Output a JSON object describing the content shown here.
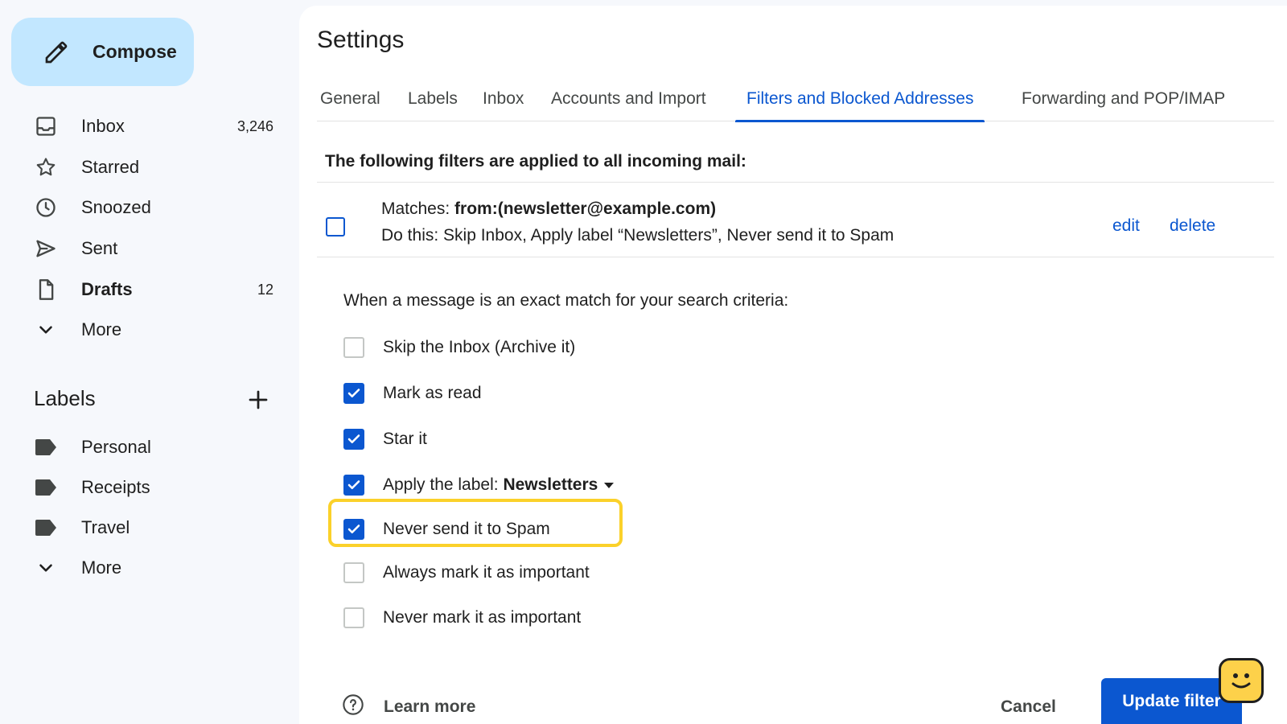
{
  "sidebar": {
    "compose_label": "Compose",
    "nav": [
      {
        "label": "Inbox",
        "count": "3,246",
        "icon": "inbox-icon"
      },
      {
        "label": "Starred",
        "count": "",
        "icon": "star-icon"
      },
      {
        "label": "Snoozed",
        "count": "",
        "icon": "clock-icon"
      },
      {
        "label": "Sent",
        "count": "",
        "icon": "send-icon"
      },
      {
        "label": "Drafts",
        "count": "12",
        "icon": "draft-icon"
      },
      {
        "label": "More",
        "count": "",
        "icon": "chevron-down-icon"
      }
    ],
    "labels_heading": "Labels",
    "labels": [
      {
        "label": "Personal",
        "icon": "label-icon"
      },
      {
        "label": "Receipts",
        "icon": "label-icon"
      },
      {
        "label": "Travel",
        "icon": "label-icon"
      },
      {
        "label": "More",
        "icon": "chevron-down-icon"
      }
    ]
  },
  "main": {
    "title": "Settings",
    "tabs": [
      {
        "label": "General"
      },
      {
        "label": "Labels"
      },
      {
        "label": "Inbox"
      },
      {
        "label": "Accounts and Import"
      },
      {
        "label": "Filters and Blocked Addresses",
        "active": true
      },
      {
        "label": "Forwarding and POP/IMAP"
      }
    ],
    "section_title": "The following filters are applied to all incoming mail:",
    "filter": {
      "matches_prefix": "Matches:",
      "matches_value": "from:(newsletter@example.com)",
      "action": "Do this: Skip Inbox, Apply label “Newsletters”, Never send it to Spam",
      "edit_label": "edit",
      "delete_label": "delete"
    },
    "criteria_text": "When a message is an exact match for your search criteria:",
    "options": [
      {
        "label": "Skip the Inbox (Archive it)",
        "checked": false
      },
      {
        "label": "Mark as read",
        "checked": true
      },
      {
        "label": "Star it",
        "checked": true
      },
      {
        "label": "Apply the label:",
        "value": "Newsletters",
        "checked": true
      },
      {
        "label": "Never send it to Spam",
        "checked": true,
        "highlighted": true
      },
      {
        "label": "Always mark it as important",
        "checked": false
      },
      {
        "label": "Never mark it as important",
        "checked": false
      }
    ],
    "learn_more": "Learn more",
    "cancel_label": "Cancel",
    "update_label": "Update filter"
  },
  "colors": {
    "accent": "#0b57d0",
    "compose_bg": "#c2e7ff",
    "highlight": "#fbd12a",
    "sidebar_bg": "#f6f8fc"
  }
}
